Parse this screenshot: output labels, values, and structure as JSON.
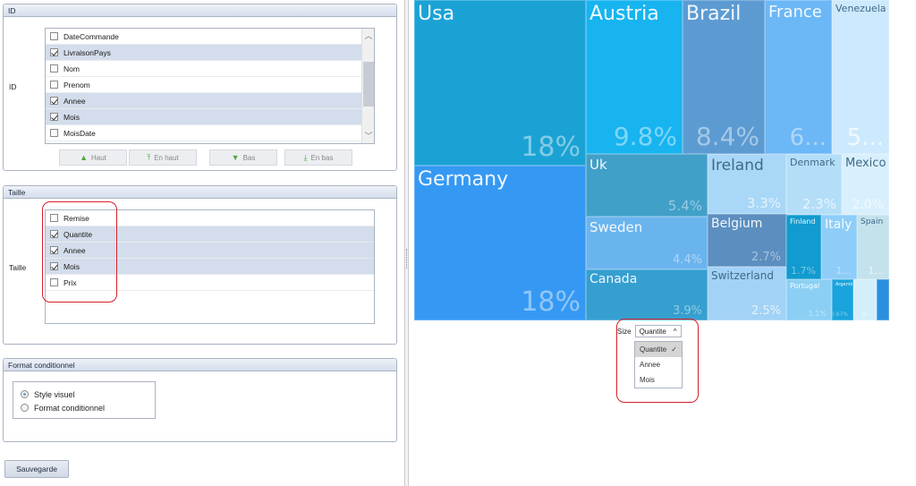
{
  "id_panel": {
    "header": "ID",
    "field_label": "ID",
    "items": [
      {
        "label": "DateCommande",
        "checked": false
      },
      {
        "label": "LivraisonPays",
        "checked": true
      },
      {
        "label": "Nom",
        "checked": false
      },
      {
        "label": "Prenom",
        "checked": false
      },
      {
        "label": "Annee",
        "checked": true
      },
      {
        "label": "Mois",
        "checked": true
      },
      {
        "label": "MoisDate",
        "checked": false
      }
    ],
    "buttons": {
      "up": "Haut",
      "top": "En haut",
      "down": "Bas",
      "bottom": "En bas"
    }
  },
  "taille_panel": {
    "header": "Taille",
    "field_label": "Taille",
    "items": [
      {
        "label": "Remise",
        "checked": false
      },
      {
        "label": "Quantite",
        "checked": true
      },
      {
        "label": "Annee",
        "checked": true
      },
      {
        "label": "Mois",
        "checked": true
      },
      {
        "label": "Prix",
        "checked": false
      }
    ]
  },
  "format_panel": {
    "header": "Format conditionnel",
    "options": [
      {
        "label": "Style visuel",
        "selected": true
      },
      {
        "label": "Format conditionnel",
        "selected": false
      }
    ]
  },
  "save_label": "Sauvegarde",
  "size_control": {
    "label": "Size",
    "selected": "Quantite",
    "options": [
      "Quantite",
      "Annee",
      "Mois"
    ],
    "check_glyph": "✓",
    "caret_glyph": "^"
  },
  "chart_data": {
    "type": "treemap",
    "tiles": [
      {
        "name": "Usa",
        "value": "18%",
        "color": "#1ba2d4"
      },
      {
        "name": "Germany",
        "value": "18%",
        "color": "#3599f3"
      },
      {
        "name": "Austria",
        "value": "9.8%",
        "color": "#17b4f0"
      },
      {
        "name": "Brazil",
        "value": "8.4%",
        "color": "#5c9bd2"
      },
      {
        "name": "France",
        "value": "6...",
        "color": "#6cb7f6"
      },
      {
        "name": "Venezuela",
        "value": "5...",
        "color": "#cde9fd"
      },
      {
        "name": "Uk",
        "value": "5.4%",
        "color": "#41a0c8"
      },
      {
        "name": "Ireland",
        "value": "3.3%",
        "color": "#a9d7f7"
      },
      {
        "name": "Denmark",
        "value": "2.3%",
        "color": "#b4def8"
      },
      {
        "name": "Mexico",
        "value": "2.0%",
        "color": "#d8effd"
      },
      {
        "name": "Sweden",
        "value": "4.4%",
        "color": "#6ab4ee"
      },
      {
        "name": "Belgium",
        "value": "2.7%",
        "color": "#5c8fc0"
      },
      {
        "name": "Finland",
        "value": "1.7%",
        "color": "#119bd0"
      },
      {
        "name": "Italy",
        "value": "1...",
        "color": "#8ecdf8"
      },
      {
        "name": "Spain",
        "value": "1...",
        "color": "#c3e2ec"
      },
      {
        "name": "Canada",
        "value": "3.9%",
        "color": "#359fd0"
      },
      {
        "name": "Switzerland",
        "value": "2.5%",
        "color": "#a2d2f6"
      },
      {
        "name": "Portugal",
        "value": "1.1%",
        "color": "#8bd0f4"
      },
      {
        "name": "Argentina",
        "value": "0.67%",
        "color": "#1aa3dc"
      },
      {
        "name": "",
        "value": "0...",
        "color": "#d4eefc"
      },
      {
        "name": "",
        "value": "",
        "color": "#2a8fdf"
      }
    ]
  }
}
